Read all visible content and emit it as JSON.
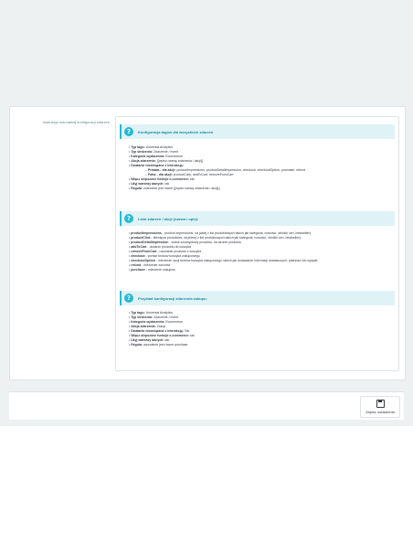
{
  "form": {
    "side_label": "Instrukcja manualnej konfiguracji zdarzeń",
    "section1": {
      "title": "Konfiguracja tagów dla wszystkich zdarzeń",
      "items": [
        {
          "key": "Typ tagu:",
          "value": " Universal Analytics"
        },
        {
          "key": "Typ śledzenia:",
          "value": " Zdarzenie / event"
        },
        {
          "key": "Kategoria wydarzenia:",
          "value": " Ecommerce"
        },
        {
          "key": "Akcja zdarzenia:",
          "value": " {{wpisz nazwę zdarzenia / akcji}}"
        },
        {
          "key": "Działanie niezwiązane z interakcją:",
          "value": ""
        },
        {
          "key": "Prawda - dla akcji:",
          "value": " productImpressions, productDetailImpression, checkout, checkoutOption, purchase, refund",
          "sub": true
        },
        {
          "key": "Fałsz - dla akcji:",
          "value": " productClick, addToCart, removeFromCart",
          "sub": true
        },
        {
          "key": "Włącz ulepszone funkcje e-commerce:",
          "value": " tak"
        },
        {
          "key": "Użyj warstwy danych:",
          "value": " tak"
        },
        {
          "key": "Reguła:",
          "value": " zdarzenie jest równe {{wpisz nazwę zdarzenia / akcji}}"
        }
      ]
    },
    "section2": {
      "title": "Lista zdarzeń / akcji (nazwa i opis):",
      "items": [
        {
          "key": "productImpressions",
          "value": " - product impressions, na jakiej z list produktowych takich jak kategoria, nowości, obniżki cen, bestsellery"
        },
        {
          "key": "productClick",
          "value": " - kliknięcia produktów, na jednej z list produktowych takich jak kategoria, nowości, obniżki cen, bestsellery"
        },
        {
          "key": "productDetailImpression",
          "value": " - widok szczegółowy produktu, na stronie produktu"
        },
        {
          "key": "addToCart",
          "value": " - dodanie produktu do koszyka"
        },
        {
          "key": "removeFromCart",
          "value": " - usuwanie produktu z koszyka"
        },
        {
          "key": "checkout",
          "value": " - pomiar kroków koszyka zakupowego"
        },
        {
          "key": "checkoutOption",
          "value": " - mierzenie opcji kroków koszyka zakupowego, takich jak dodawanie informacji dostawczych, płatności lub wysyłki"
        },
        {
          "key": "refund",
          "value": " - mierzenie zwrotów"
        },
        {
          "key": "purchase",
          "value": " - mierzenie zakupów"
        }
      ]
    },
    "section3": {
      "title": "Przykład konfiguracji zdarzenia zakupu:",
      "items": [
        {
          "key": "Typ tagu:",
          "value": " Universal Analytics"
        },
        {
          "key": "Typ śledzenia:",
          "value": " Zdarzenie / event"
        },
        {
          "key": "Kategoria wydarzenia:",
          "value": " Ecommerce"
        },
        {
          "key": "Akcja zdarzenia:",
          "value": " Zakup"
        },
        {
          "key": "Działanie niezwiązane z interakcją:",
          "value": " Tak"
        },
        {
          "key": "Włącz ulepszone funkcje e-commerce:",
          "value": " tak"
        },
        {
          "key": "Użyj warstwy danych:",
          "value": " tak"
        },
        {
          "key": "Reguła:",
          "value": " wywołanie jest równe purchase"
        }
      ]
    }
  },
  "footer": {
    "save_label": "Zapisz ustawienia",
    "save_icon": "floppy-disk-icon"
  },
  "colors": {
    "accent": "#25b9d7",
    "help_bg": "#dff3f7",
    "page_bg": "#eef1f2"
  }
}
